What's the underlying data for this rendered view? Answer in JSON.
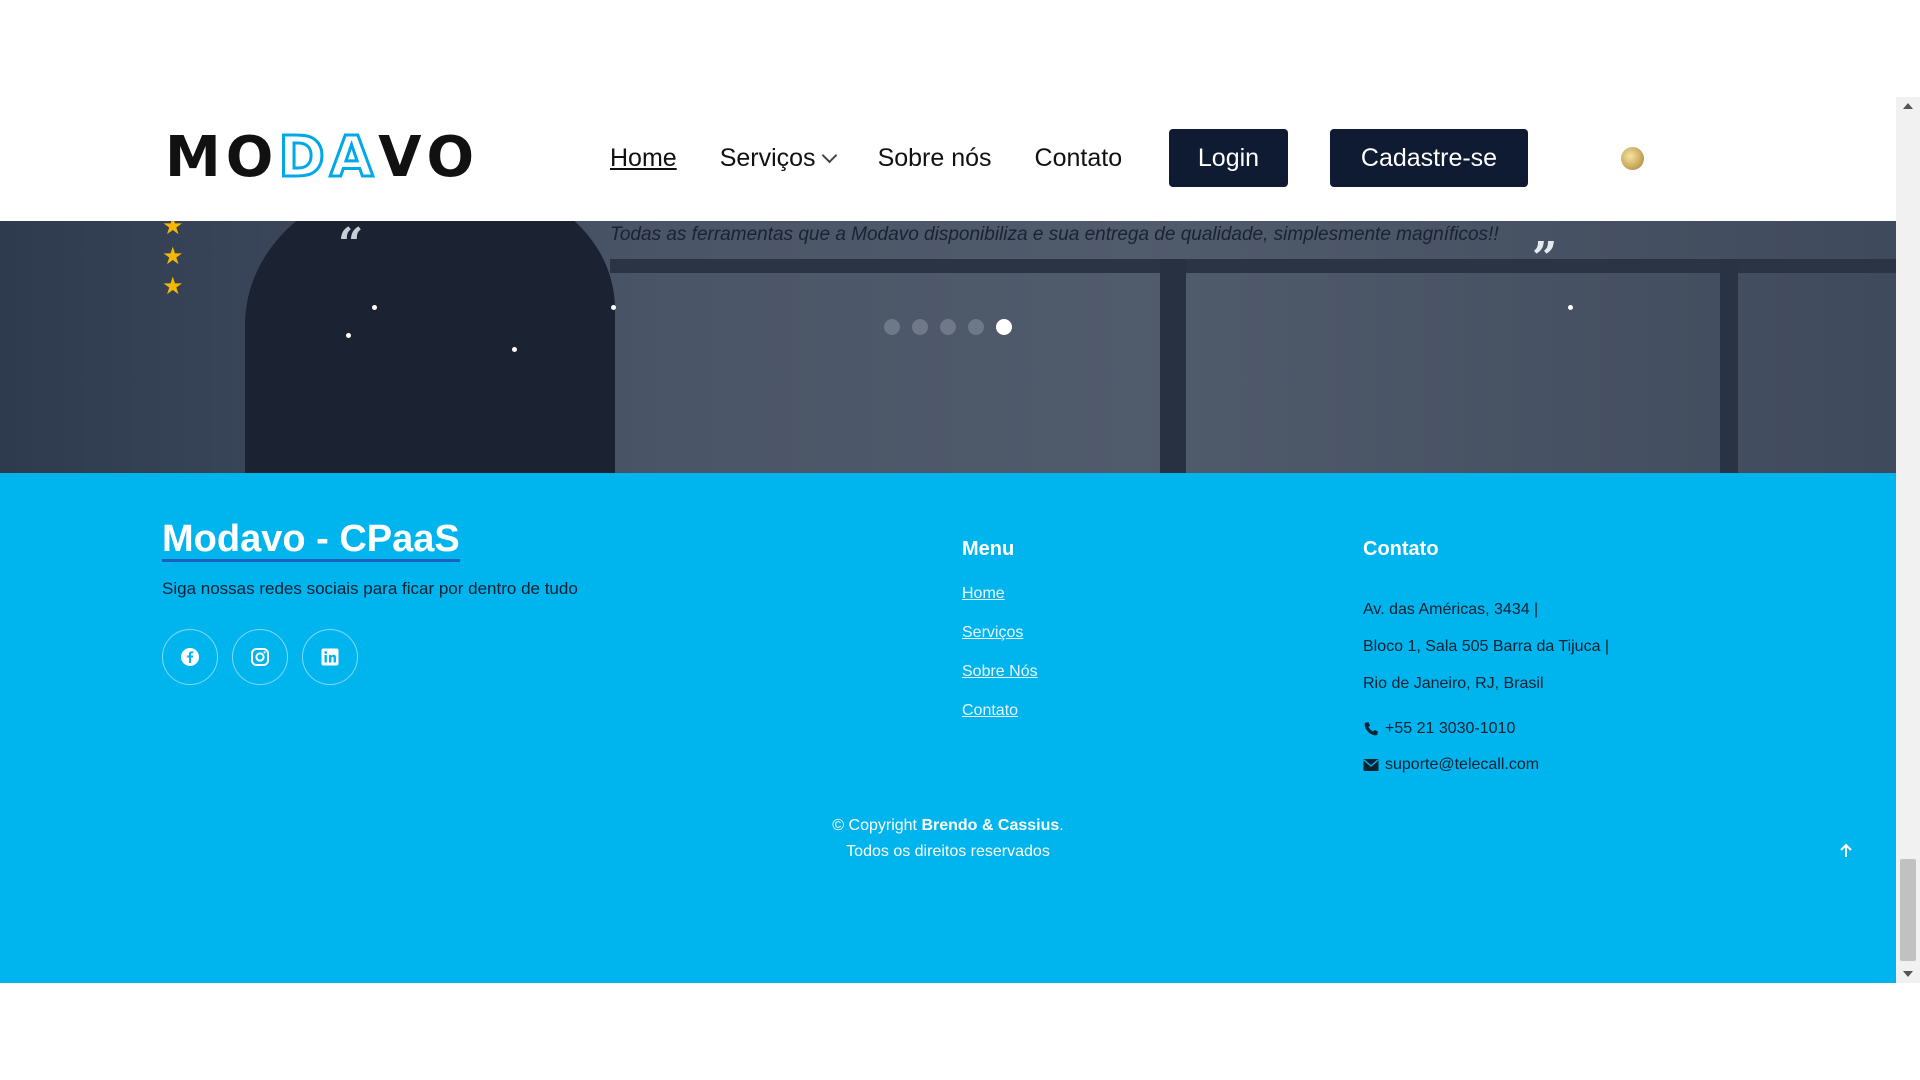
{
  "header": {
    "logo_text": "MODAVO",
    "nav": [
      {
        "label": "Home",
        "active": true
      },
      {
        "label": "Serviços",
        "dropdown": true
      },
      {
        "label": "Sobre nós"
      },
      {
        "label": "Contato"
      }
    ],
    "login_label": "Login",
    "signup_label": "Cadastre-se",
    "language_icon": "globe-flag-icon"
  },
  "hero": {
    "rating_stars": 3,
    "testimonial": "Todas as ferramentas que a Modavo disponibiliza e sua entrega de qualidade, simplesmente magníficos!!",
    "quote_open": "“",
    "quote_close": "”",
    "slider": {
      "count": 5,
      "active_index": 4
    }
  },
  "footer": {
    "brand": "Modavo - CPaaS",
    "tagline": "Siga nossas redes sociais para ficar por dentro de tudo",
    "socials": [
      "facebook-icon",
      "instagram-icon",
      "linkedin-icon"
    ],
    "menu_title": "Menu",
    "menu_links": [
      "Home",
      "Serviços",
      "Sobre Nós",
      "Contato"
    ],
    "contact_title": "Contato",
    "address_lines": [
      "Av. das Américas, 3434 |",
      "Bloco 1, Sala 505 Barra da Tijuca |",
      "Rio de Janeiro, RJ, Brasil"
    ],
    "phone": "+55 21 3030-1010",
    "email": "suporte@telecall.com",
    "copyright_prefix": "© Copyright",
    "copyright_names": "Brendo & Cassius",
    "copyright_suffix": ".",
    "rights": "Todos os direitos reservados"
  },
  "colors": {
    "footer_bg": "#00b4ee",
    "button_dark": "#0f1b33",
    "star": "#f5b800",
    "logo_accent": "#00a8e8"
  }
}
